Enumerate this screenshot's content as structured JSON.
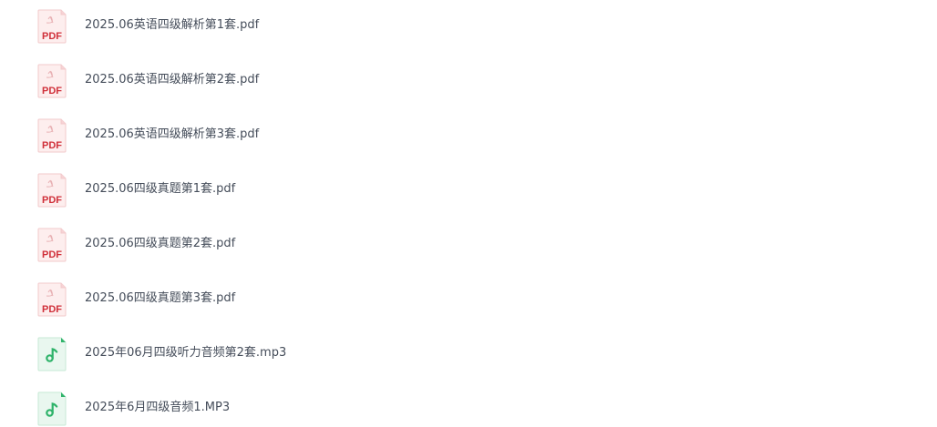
{
  "files": [
    {
      "name": "2025.06英语四级解析第1套.pdf",
      "icon": "pdf-file-icon",
      "badge": "PDF"
    },
    {
      "name": "2025.06英语四级解析第2套.pdf",
      "icon": "pdf-file-icon",
      "badge": "PDF"
    },
    {
      "name": "2025.06英语四级解析第3套.pdf",
      "icon": "pdf-file-icon",
      "badge": "PDF"
    },
    {
      "name": "2025.06四级真题第1套.pdf",
      "icon": "pdf-file-icon",
      "badge": "PDF"
    },
    {
      "name": "2025.06四级真题第2套.pdf",
      "icon": "pdf-file-icon",
      "badge": "PDF"
    },
    {
      "name": "2025.06四级真题第3套.pdf",
      "icon": "pdf-file-icon",
      "badge": "PDF"
    },
    {
      "name": "2025年06月四级听力音频第2套.mp3",
      "icon": "audio-file-icon"
    },
    {
      "name": "2025年6月四级音频1.MP3",
      "icon": "audio-file-icon"
    }
  ],
  "colors": {
    "pdf_red": "#d0303a",
    "pdf_bg": "#fdeeee",
    "audio_green": "#2fb36a",
    "audio_bg": "#e9f7ef",
    "text": "#454d5a"
  }
}
